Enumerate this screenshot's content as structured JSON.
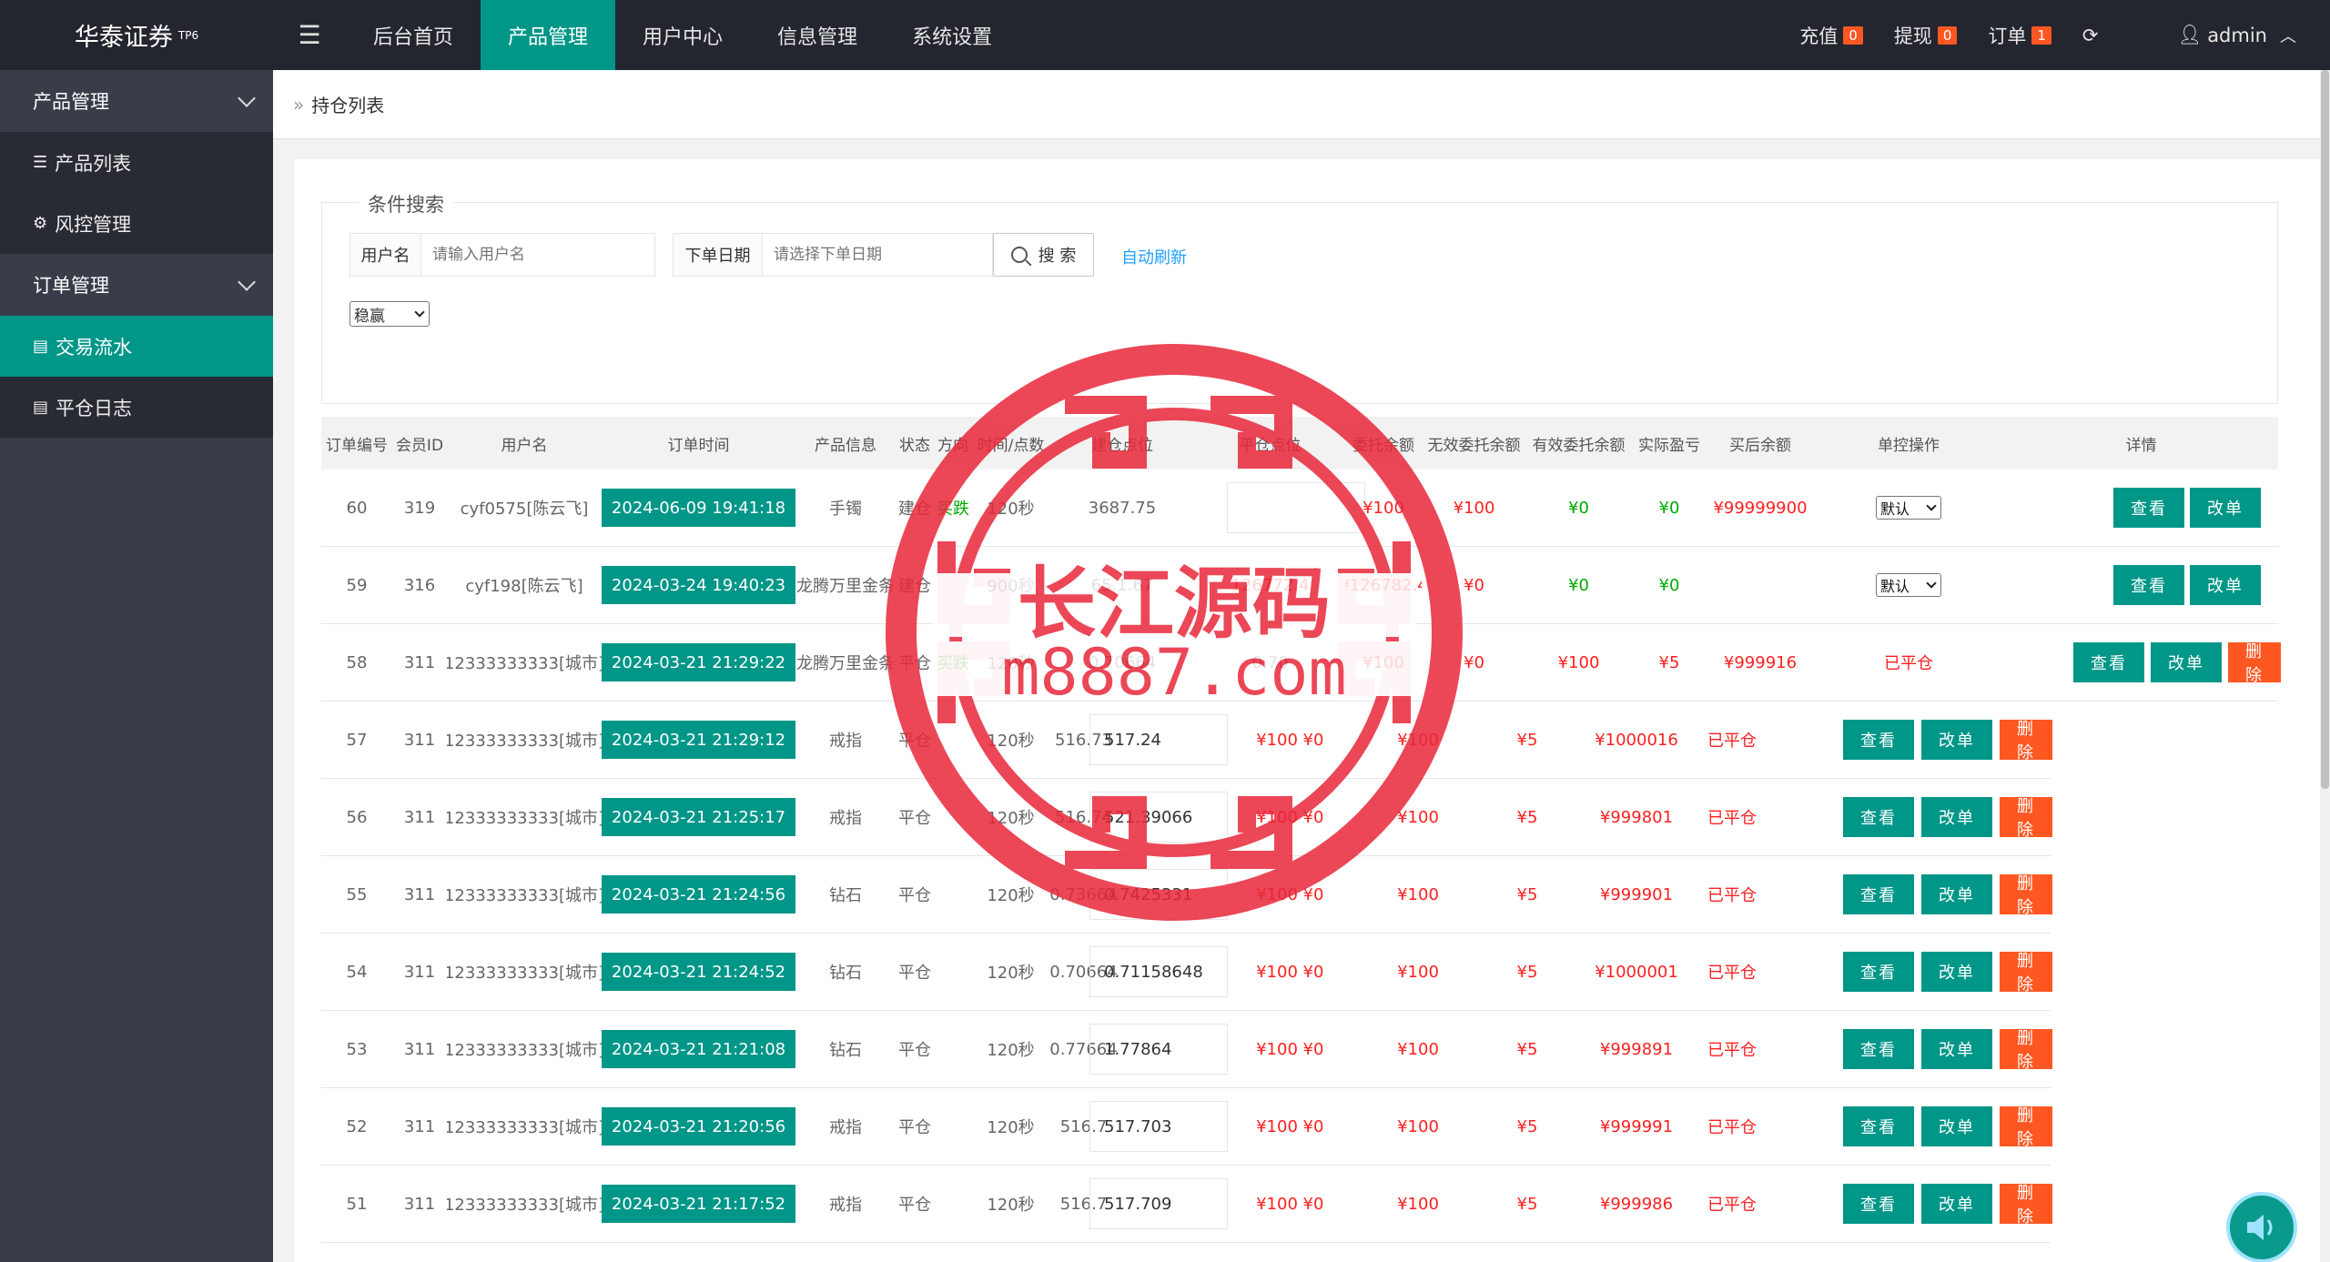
{
  "header": {
    "logo": "华泰证券",
    "logo_sup": "TP6",
    "nav": [
      "后台首页",
      "产品管理",
      "用户中心",
      "信息管理",
      "系统设置"
    ],
    "right": {
      "recharge": "充值",
      "recharge_count": "0",
      "withdraw": "提现",
      "withdraw_count": "0",
      "order": "订单",
      "order_count": "1",
      "admin": "admin"
    }
  },
  "sidebar": {
    "group1": "产品管理",
    "item1": "产品列表",
    "item2": "风控管理",
    "group2": "订单管理",
    "item3": "交易流水",
    "item4": "平仓日志"
  },
  "breadcrumb": "持仓列表",
  "search": {
    "legend": "条件搜索",
    "user_label": "用户名",
    "user_placeholder": "请输入用户名",
    "date_label": "下单日期",
    "date_placeholder": "请选择下单日期",
    "search_btn": "搜 索",
    "auto_refresh": "自动刷新",
    "filter_select": "稳赢"
  },
  "table": {
    "headers": [
      "订单编号",
      "会员ID",
      "用户名",
      "订单时间",
      "产品信息",
      "状态",
      "方向",
      "时间/点数",
      "建仓点位",
      "平仓点位",
      "委托余额",
      "无效委托余额",
      "有效委托余额",
      "实际盈亏",
      "买后余额",
      "单控操作",
      "详情"
    ],
    "rows": [
      {
        "id": "60",
        "uid": "319",
        "user": "cyf0575[陈云飞]",
        "time": "2024-06-09 19:41:18",
        "product": "手镯",
        "status": "建仓",
        "dir": "买跌",
        "period": "120秒",
        "open": "3687.75",
        "close": "",
        "amt": "¥100",
        "invalid": "¥100",
        "valid": "¥0",
        "pl": "¥0",
        "after": "¥99999900",
        "control": "默认"
      },
      {
        "id": "59",
        "uid": "316",
        "user": "cyf198[陈云飞]",
        "time": "2024-03-24 19:40:23",
        "product": "龙腾万里金条",
        "status": "建仓",
        "dir": "",
        "period": "900秒",
        "open": "65.1.67",
        "close": "126772.4",
        "amt": "¥126782.4",
        "invalid": "¥0",
        "valid": "¥0",
        "pl": "¥0",
        "after": "",
        "control": "默认"
      },
      {
        "id": "58",
        "uid": "311",
        "user": "12333333333[城市]",
        "time": "2024-03-21 21:29:22",
        "product": "龙腾万里金条",
        "status": "平仓",
        "dir": "买跌",
        "period": "120秒",
        "open": "0.70664",
        "close": "0.70",
        "amt": "¥100",
        "invalid": "¥0",
        "valid": "¥100",
        "pl": "¥5",
        "after": "¥999916",
        "state": "已平仓"
      },
      {
        "id": "57",
        "uid": "311",
        "user": "12333333333[城市]",
        "time": "2024-03-21 21:29:12",
        "product": "戒指",
        "status": "平仓",
        "dir": "",
        "period": "120秒",
        "open": "516.73",
        "close": "517.24",
        "amt": "¥100",
        "invalid": "¥0",
        "valid": "¥100",
        "pl": "¥5",
        "after": "¥1000016",
        "state": "已平仓"
      },
      {
        "id": "56",
        "uid": "311",
        "user": "12333333333[城市]",
        "time": "2024-03-21 21:25:17",
        "product": "戒指",
        "status": "平仓",
        "dir": "",
        "period": "120秒",
        "open": "516.74",
        "close": "521.39066",
        "amt": "¥100",
        "invalid": "¥0",
        "valid": "¥100",
        "pl": "¥5",
        "after": "¥999801",
        "state": "已平仓"
      },
      {
        "id": "55",
        "uid": "311",
        "user": "12333333333[城市]",
        "time": "2024-03-21 21:24:56",
        "product": "钻石",
        "status": "平仓",
        "dir": "",
        "period": "120秒",
        "open": "0.73664",
        "close": "0.7425331",
        "amt": "¥100",
        "invalid": "¥0",
        "valid": "¥100",
        "pl": "¥5",
        "after": "¥999901",
        "state": "已平仓"
      },
      {
        "id": "54",
        "uid": "311",
        "user": "12333333333[城市]",
        "time": "2024-03-21 21:24:52",
        "product": "钻石",
        "status": "平仓",
        "dir": "",
        "period": "120秒",
        "open": "0.70664",
        "close": "0.71158648",
        "amt": "¥100",
        "invalid": "¥0",
        "valid": "¥100",
        "pl": "¥5",
        "after": "¥1000001",
        "state": "已平仓"
      },
      {
        "id": "53",
        "uid": "311",
        "user": "12333333333[城市]",
        "time": "2024-03-21 21:21:08",
        "product": "钻石",
        "status": "平仓",
        "dir": "",
        "period": "120秒",
        "open": "0.77664",
        "close": "1.77864",
        "amt": "¥100",
        "invalid": "¥0",
        "valid": "¥100",
        "pl": "¥5",
        "after": "¥999891",
        "state": "已平仓"
      },
      {
        "id": "52",
        "uid": "311",
        "user": "12333333333[城市]",
        "time": "2024-03-21 21:20:56",
        "product": "戒指",
        "status": "平仓",
        "dir": "",
        "period": "120秒",
        "open": "516.7",
        "close": "517.703",
        "amt": "¥100",
        "invalid": "¥0",
        "valid": "¥100",
        "pl": "¥5",
        "after": "¥999991",
        "state": "已平仓"
      },
      {
        "id": "51",
        "uid": "311",
        "user": "12333333333[城市]",
        "time": "2024-03-21 21:17:52",
        "product": "戒指",
        "status": "平仓",
        "dir": "",
        "period": "120秒",
        "open": "516.7",
        "close": "517.709",
        "amt": "¥100",
        "invalid": "¥0",
        "valid": "¥100",
        "pl": "¥5",
        "after": "¥999986",
        "state": "已平仓"
      }
    ],
    "btn_view": "查看",
    "btn_edit": "改单",
    "btn_delete": "删除"
  },
  "watermark": {
    "line1": "长江源码",
    "line2": "m8887.com"
  },
  "colors": {
    "accent": "#009688",
    "danger": "#ff5722",
    "header": "#23262e",
    "sidebar": "#393d49"
  }
}
